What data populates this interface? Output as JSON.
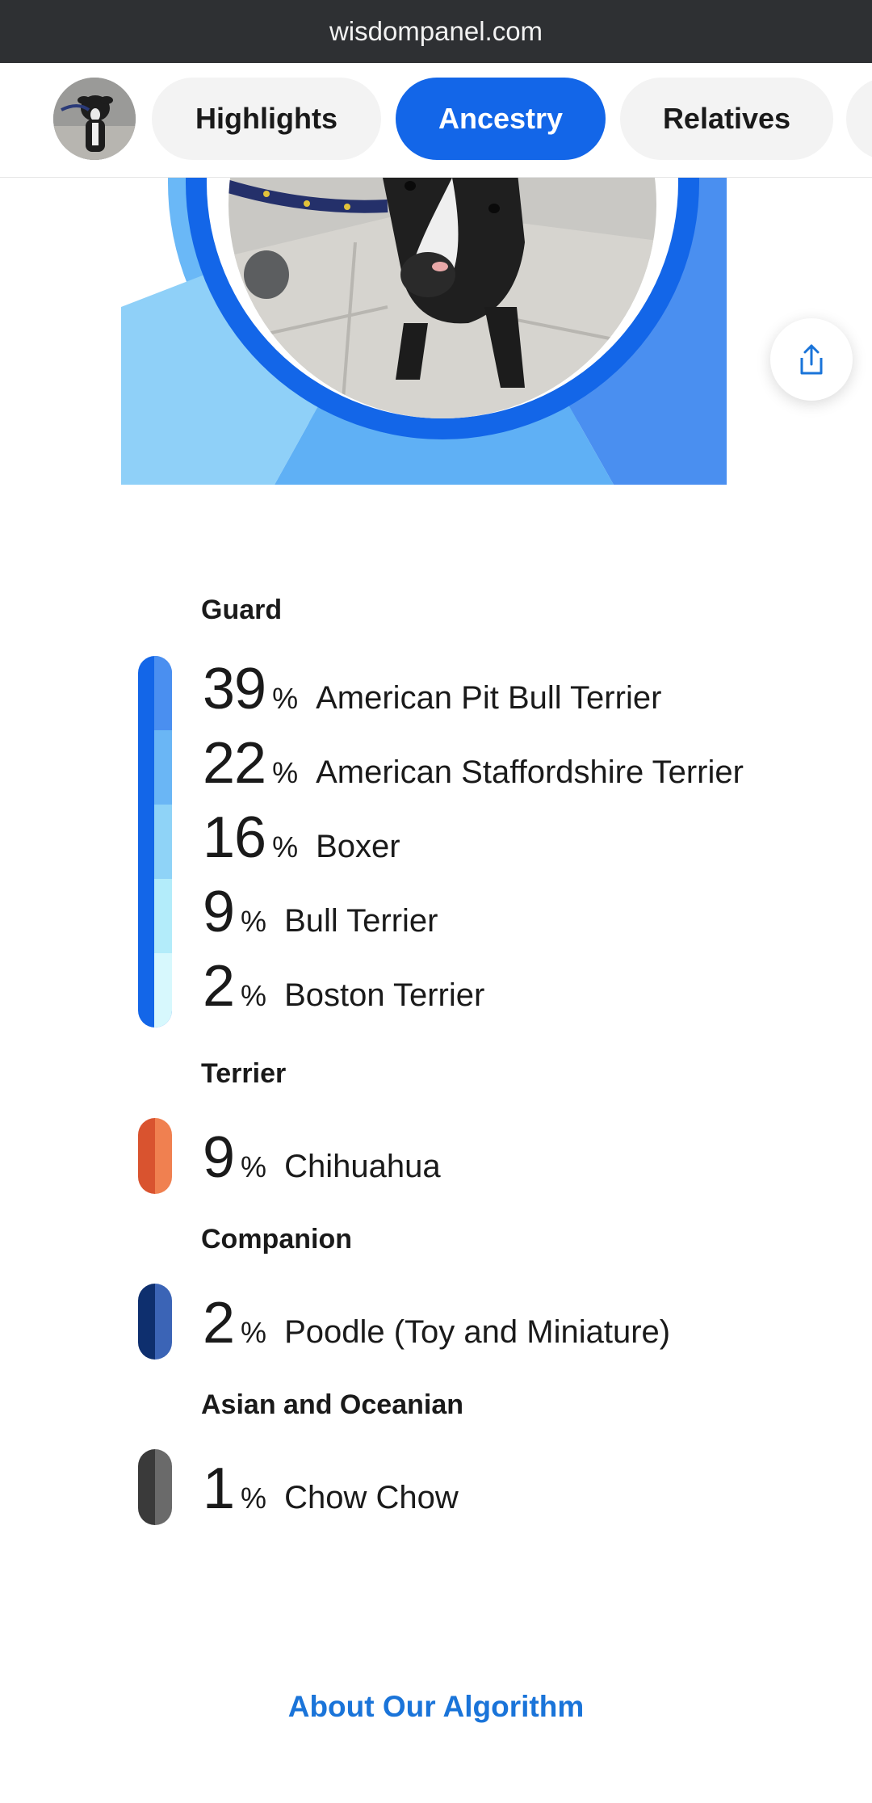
{
  "browser": {
    "url": "wisdompanel.com"
  },
  "nav": {
    "tabs": [
      {
        "label": "Highlights",
        "active": false
      },
      {
        "label": "Ancestry",
        "active": true
      },
      {
        "label": "Relatives",
        "active": false
      }
    ]
  },
  "colors": {
    "accent": "#1366e8",
    "guard": [
      "#4a8ff0",
      "#6ab6f5",
      "#8fd3f7",
      "#b3ecfa",
      "#d7f8fd"
    ],
    "guard_base": "#1366e8",
    "terrier": [
      "#d9532f",
      "#f08050"
    ],
    "companion": [
      "#0e2f6e",
      "#3b64b6"
    ],
    "asian": [
      "#3a3a3a",
      "#6a6a6a"
    ],
    "link": "#1a74d9"
  },
  "ancestry": {
    "groups": [
      {
        "name": "Guard",
        "breeds": [
          {
            "percent": "39",
            "sign": "%",
            "name": "American Pit Bull Terrier"
          },
          {
            "percent": "22",
            "sign": "%",
            "name": "American Staffordshire Terrier"
          },
          {
            "percent": "16",
            "sign": "%",
            "name": "Boxer"
          },
          {
            "percent": "9",
            "sign": "%",
            "name": "Bull Terrier"
          },
          {
            "percent": "2",
            "sign": "%",
            "name": "Boston Terrier"
          }
        ]
      },
      {
        "name": "Terrier",
        "breeds": [
          {
            "percent": "9",
            "sign": "%",
            "name": "Chihuahua"
          }
        ]
      },
      {
        "name": "Companion",
        "breeds": [
          {
            "percent": "2",
            "sign": "%",
            "name": "Poodle (Toy and Miniature)"
          }
        ]
      },
      {
        "name": "Asian and Oceanian",
        "breeds": [
          {
            "percent": "1",
            "sign": "%",
            "name": "Chow Chow"
          }
        ]
      }
    ]
  },
  "footer": {
    "link_label": "About Our Algorithm"
  },
  "icons": {
    "share": "share-icon",
    "avatar": "dog-avatar"
  }
}
